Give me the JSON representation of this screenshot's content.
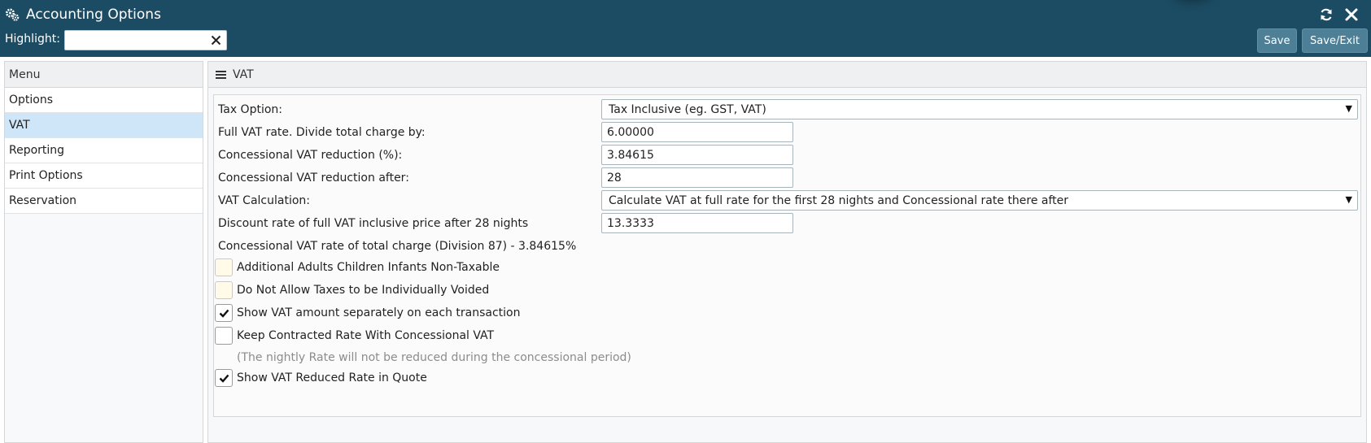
{
  "window": {
    "title": "Accounting Options",
    "title_icon": "cogs-icon",
    "refresh_icon": "refresh-icon",
    "close_icon": "close-icon"
  },
  "highlight": {
    "label": "Highlight:",
    "value": "",
    "placeholder": "",
    "clear_icon": "clear-icon"
  },
  "toolbar": {
    "save_label": "Save",
    "save_exit_label": "Save/Exit"
  },
  "menu": {
    "heading": "Menu",
    "items": [
      {
        "label": "Options",
        "active": false
      },
      {
        "label": "VAT",
        "active": true
      },
      {
        "label": "Reporting",
        "active": false
      },
      {
        "label": "Print Options",
        "active": false
      },
      {
        "label": "Reservation",
        "active": false
      }
    ]
  },
  "section": {
    "icon": "menu-bars-icon",
    "title": "VAT"
  },
  "form": {
    "tax_option": {
      "label": "Tax Option:",
      "value": "Tax Inclusive (eg. GST, VAT)"
    },
    "full_vat_rate": {
      "label": "Full VAT rate. Divide total charge by:",
      "value": "6.00000"
    },
    "concessional_reduction": {
      "label": "Concessional VAT reduction (%):",
      "value": "3.84615"
    },
    "concessional_after": {
      "label": "Concessional VAT reduction after:",
      "value": "28"
    },
    "vat_calculation": {
      "label": "VAT Calculation:",
      "value": "Calculate VAT at full rate for the first 28 nights and Concessional rate there after"
    },
    "discount_rate": {
      "label": "Discount rate of full VAT inclusive price after 28 nights",
      "value": "13.3333"
    },
    "concessional_note": "Concessional VAT rate of total charge (Division 87) - 3.84615%",
    "checkboxes": [
      {
        "label": "Additional Adults Children Infants Non-Taxable",
        "checked": false
      },
      {
        "label": "Do Not Allow Taxes to be Individually Voided",
        "checked": false
      },
      {
        "label": "Show VAT amount separately on each transaction",
        "checked": true
      },
      {
        "label": "Keep Contracted Rate With Concessional VAT",
        "checked": false
      },
      {
        "label": "Show VAT Reduced Rate in Quote",
        "checked": true
      }
    ],
    "keep_rate_note": "(The nightly Rate will not be reduced during the concessional period)"
  },
  "colors": {
    "header_bg": "#1c4c63",
    "button_bg": "#4d7f96",
    "active_menu_bg": "#cfe6f8",
    "unset_checkbox_bg": "#fffbe8"
  }
}
